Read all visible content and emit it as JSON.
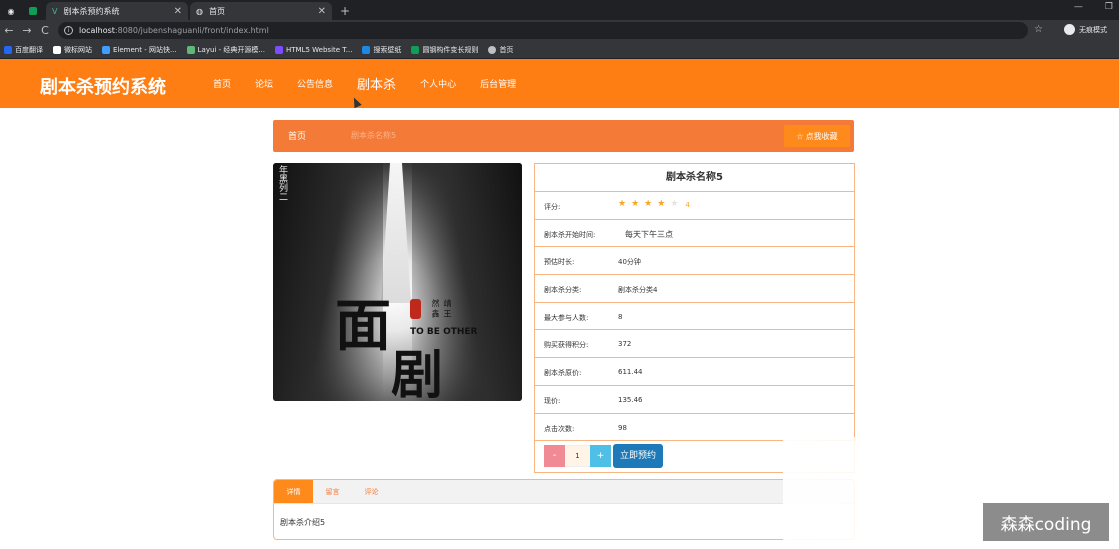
{
  "browser": {
    "tabs": [
      {
        "title": "剧本杀预约系统"
      },
      {
        "title": "首页"
      }
    ],
    "url_host": "localhost",
    "url_rest": ":8080/jubenshaguanli/front/index.html",
    "profile_label": "无痕模式",
    "bookmarks": [
      {
        "label": "百度翻译",
        "color": "#2468f2"
      },
      {
        "label": "微标网站",
        "color": "#ffffff"
      },
      {
        "label": "Element - 网站快...",
        "color": "#409eff"
      },
      {
        "label": "Layui - 经典开源模...",
        "color": "#5fb878"
      },
      {
        "label": "HTML5 Website T...",
        "color": "#7c4dff"
      },
      {
        "label": "搜索壁纸",
        "color": "#1e88e5"
      },
      {
        "label": "圆钢构件变长规则",
        "color": "#0f9d58"
      },
      {
        "label": "首页",
        "color": "#bdc1c6"
      }
    ]
  },
  "app": {
    "logo": "剧本杀预约系统",
    "menu": [
      "首页",
      "论坛",
      "公告信息",
      "剧本杀",
      "个人中心",
      "后台管理"
    ]
  },
  "breadcrumb": {
    "home": "首页",
    "current": "剧本杀名称5",
    "collect": "点我收藏"
  },
  "poster": {
    "vertical_title": "年黑列二",
    "main_char_1": "面",
    "main_char_2": "剧",
    "names": "靖 王 然 鑫",
    "english": "TO BE OTHER"
  },
  "details": {
    "name": "剧本杀名称5",
    "rating_label": "评分:",
    "rating_value": 4,
    "rating_max": 5,
    "rating_text": "4",
    "rows": [
      {
        "label": "剧本杀开始时间:",
        "value": "每天下午三点"
      },
      {
        "label": "预估时长:",
        "value": "40分钟"
      },
      {
        "label": "剧本杀分类:",
        "value": "剧本杀分类4"
      },
      {
        "label": "最大参与人数:",
        "value": "8"
      },
      {
        "label": "购买获得积分:",
        "value": "372"
      },
      {
        "label": "剧本杀原价:",
        "value": "611.44"
      },
      {
        "label": "现价:",
        "value": "135.46"
      },
      {
        "label": "点击次数:",
        "value": "98"
      }
    ],
    "quantity": "1",
    "minus": "-",
    "plus": "+",
    "reserve": "立即预约"
  },
  "tabs": {
    "items": [
      "详情",
      "留言",
      "评论"
    ],
    "active_index": 0,
    "content": "剧本杀介绍5"
  },
  "watermark": "森森coding"
}
